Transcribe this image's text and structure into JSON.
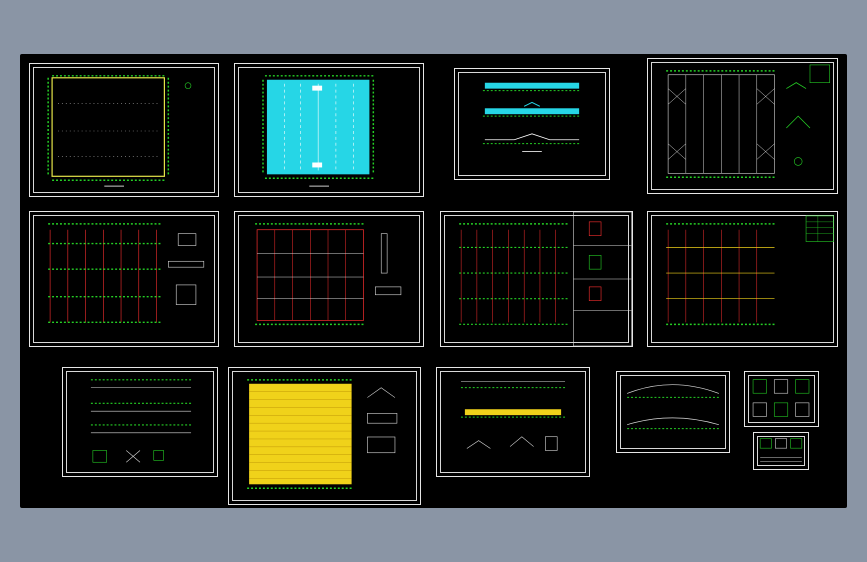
{
  "viewer": {
    "background": "#8a95a5",
    "canvas_color": "#000000",
    "line_color": "#25d025",
    "accent_red": "#ff3030",
    "accent_cyan": "#26d6e6",
    "accent_yellow": "#f0d21a"
  },
  "sheets": [
    {
      "id": "s1",
      "kind": "plan-empty"
    },
    {
      "id": "s2",
      "kind": "plan-cyan"
    },
    {
      "id": "s3",
      "kind": "elevations"
    },
    {
      "id": "s4",
      "kind": "roof-bracing"
    },
    {
      "id": "s5",
      "kind": "frame-plan"
    },
    {
      "id": "s6",
      "kind": "frame-plan"
    },
    {
      "id": "s7",
      "kind": "frame-plan-details"
    },
    {
      "id": "s8",
      "kind": "frame-plan-table"
    },
    {
      "id": "s9",
      "kind": "sections"
    },
    {
      "id": "s10",
      "kind": "plan-yellow"
    },
    {
      "id": "s11",
      "kind": "elevation-yellow"
    },
    {
      "id": "s12",
      "kind": "arch-elevation"
    },
    {
      "id": "s13",
      "kind": "details-a"
    },
    {
      "id": "s14",
      "kind": "details-b"
    }
  ]
}
